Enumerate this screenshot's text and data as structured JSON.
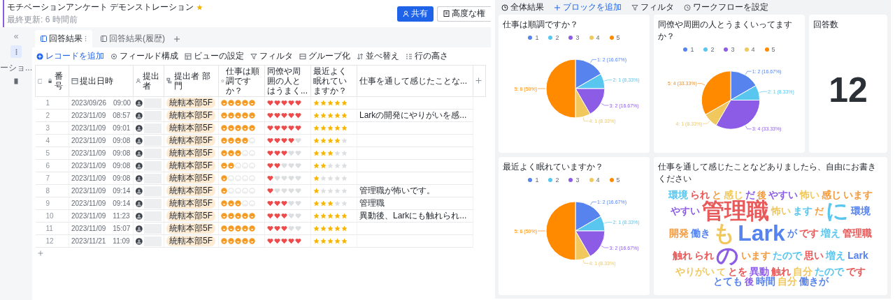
{
  "header": {
    "title": "モチベーションアンケート デモンストレーション",
    "starred": true,
    "subtitle": "最終更新: 6 時間前",
    "buttons": [
      {
        "label": "共有",
        "kind": "primary"
      },
      {
        "label": "高度な権",
        "kind": "outline"
      }
    ]
  },
  "sidebar": {
    "collapse": "«",
    "view_label": "ーショ..."
  },
  "tabs": [
    {
      "label": "回答結果",
      "selected": true
    },
    {
      "label": "回答結果(履歴)",
      "selected": false
    }
  ],
  "toolbar": [
    {
      "label": "レコードを追加",
      "kind": "add"
    },
    {
      "label": "フィールド構成",
      "kind": "fields"
    },
    {
      "label": "ビューの設定",
      "kind": "view"
    },
    {
      "label": "フィルタ",
      "kind": "filter"
    },
    {
      "label": "グループ化",
      "kind": "group"
    },
    {
      "label": "並べ替え",
      "kind": "sort"
    },
    {
      "label": "行の高さ",
      "kind": "height"
    }
  ],
  "table": {
    "select_all": {
      "checked": false
    },
    "columns": [
      {
        "label": "番号",
        "kind": "number"
      },
      {
        "label": "提出日時",
        "kind": "date"
      },
      {
        "label": "提出者",
        "kind": "person"
      },
      {
        "label": "提出者 部門",
        "kind": "dept"
      },
      {
        "label": "仕事は順調ですか？",
        "kind": "rating"
      },
      {
        "label": "同僚や周囲の人とはうまく...",
        "kind": "text"
      },
      {
        "label": "最近よく眠れていますか？",
        "kind": "text"
      },
      {
        "label": "仕事を通して感じたことな...",
        "kind": "text"
      }
    ],
    "rows": [
      {
        "number": "1",
        "date": "2023/09/26",
        "time": "09:00",
        "department": "統轄本部5F",
        "ratings": [
          {
            "kind": "face",
            "stars": 5
          },
          {
            "kind": "heart",
            "stars": 5
          },
          {
            "kind": "star",
            "stars": 5
          }
        ],
        "comment": ""
      },
      {
        "number": "2",
        "date": "2023/11/09",
        "time": "08:57",
        "department": "統轄本部5F",
        "ratings": [
          {
            "kind": "face",
            "stars": 5
          },
          {
            "kind": "heart",
            "stars": 5
          },
          {
            "kind": "star",
            "stars": 5
          }
        ],
        "comment": "Larkの開発にやりがいを感..."
      },
      {
        "number": "3",
        "date": "2023/11/09",
        "time": "09:01",
        "department": "統轄本部5F",
        "ratings": [
          {
            "kind": "face",
            "stars": 5
          },
          {
            "kind": "heart",
            "stars": 5
          },
          {
            "kind": "star",
            "stars": 5
          }
        ],
        "comment": ""
      },
      {
        "number": "4",
        "date": "2023/11/09",
        "time": "09:08",
        "department": "統轄本部5F",
        "ratings": [
          {
            "kind": "face",
            "stars": 4
          },
          {
            "kind": "heart",
            "stars": 4
          },
          {
            "kind": "star",
            "stars": 4
          }
        ],
        "comment": ""
      },
      {
        "number": "5",
        "date": "2023/11/09",
        "time": "09:08",
        "department": "統轄本部5F",
        "ratings": [
          {
            "kind": "face",
            "stars": 3
          },
          {
            "kind": "heart",
            "stars": 3
          },
          {
            "kind": "star",
            "stars": 3
          }
        ],
        "comment": ""
      },
      {
        "number": "6",
        "date": "2023/11/09",
        "time": "09:08",
        "department": "統轄本部5F",
        "ratings": [
          {
            "kind": "face",
            "stars": 2
          },
          {
            "kind": "heart",
            "stars": 2
          },
          {
            "kind": "star",
            "stars": 2
          }
        ],
        "comment": ""
      },
      {
        "number": "7",
        "date": "2023/11/09",
        "time": "09:08",
        "department": "統轄本部5F",
        "ratings": [
          {
            "kind": "face",
            "stars": 1
          },
          {
            "kind": "heart",
            "stars": 1
          },
          {
            "kind": "star",
            "stars": 1
          }
        ],
        "comment": ""
      },
      {
        "number": "8",
        "date": "2023/11/09",
        "time": "09:14",
        "department": "統轄本部5F",
        "ratings": [
          {
            "kind": "face",
            "stars": 1
          },
          {
            "kind": "heart",
            "stars": 1
          },
          {
            "kind": "star",
            "stars": 1
          }
        ],
        "comment": "管理職が怖いです。"
      },
      {
        "number": "9",
        "date": "2023/11/09",
        "time": "09:14",
        "department": "統轄本部5F",
        "ratings": [
          {
            "kind": "face",
            "stars": 3
          },
          {
            "kind": "heart",
            "stars": 3
          },
          {
            "kind": "star",
            "stars": 3
          }
        ],
        "comment": "管理職"
      },
      {
        "number": "10",
        "date": "2023/11/09",
        "time": "11:23",
        "department": "統轄本部5F",
        "ratings": [
          {
            "kind": "face",
            "stars": 5
          },
          {
            "kind": "heart",
            "stars": 3
          },
          {
            "kind": "star",
            "stars": 5
          }
        ],
        "comment": "異動後、Larkにも触れられ..."
      },
      {
        "number": "11",
        "date": "2023/11/09",
        "time": "15:07",
        "department": "統轄本部5F",
        "ratings": [
          {
            "kind": "face",
            "stars": 5
          },
          {
            "kind": "heart",
            "stars": 3
          },
          {
            "kind": "star",
            "stars": 5
          }
        ],
        "comment": ""
      },
      {
        "number": "12",
        "date": "2023/11/21",
        "time": "11:09",
        "department": "統轄本部5F",
        "ratings": [
          {
            "kind": "face",
            "stars": 5
          },
          {
            "kind": "heart",
            "stars": 5
          },
          {
            "kind": "star",
            "stars": 5
          }
        ],
        "comment": ""
      }
    ]
  },
  "dashboard": {
    "title": "全体結果",
    "toolbar": [
      {
        "label": "ブロックを追加",
        "kind": "add"
      },
      {
        "label": "フィルタ",
        "kind": "filter"
      },
      {
        "label": "ワークフローを設定",
        "kind": "workflow"
      }
    ],
    "cards": [
      {
        "kind": "pie",
        "title": "仕事は順調ですか？",
        "legend": [
          {
            "color": "#5683ee"
          },
          {
            "color": "#58c6ef"
          },
          {
            "color": "#8c5ce6"
          },
          {
            "color": "#f0c85e"
          },
          {
            "color": "#ff8a00"
          }
        ],
        "chart_data": {
          "type": "pie",
          "categories": [
            "1",
            "2",
            "3",
            "4",
            "5"
          ],
          "values": [
            2,
            1,
            2,
            1,
            6
          ],
          "value_labels": [
            "1: 2 (16.67%)",
            "2: 1 (8.33%)",
            "3: 2 (16.67%)",
            "4: 1 (8.33%)",
            "5: 6 (50%)"
          ]
        }
      },
      {
        "kind": "pie",
        "title": "同僚や周囲の人とうまくいってますか？",
        "legend": [
          {
            "color": "#5683ee"
          },
          {
            "color": "#58c6ef"
          },
          {
            "color": "#8c5ce6"
          },
          {
            "color": "#f0c85e"
          },
          {
            "color": "#ff8a00"
          }
        ],
        "chart_data": {
          "type": "pie",
          "categories": [
            "1",
            "2",
            "3",
            "4",
            "5"
          ],
          "values": [
            2,
            1,
            4,
            1,
            4
          ],
          "value_labels": [
            "1: 2 (16.67%)",
            "2: 1 (8.33%)",
            "3: 4 (33.33%)",
            "4: 1 (8.33%)",
            "5: 4 (33.33%)"
          ]
        }
      },
      {
        "kind": "metric",
        "title": "回答数",
        "value": "12"
      },
      {
        "kind": "pie",
        "title": "最近よく眠れていますか？",
        "legend": [
          {
            "color": "#5683ee"
          },
          {
            "color": "#58c6ef"
          },
          {
            "color": "#8c5ce6"
          },
          {
            "color": "#f0c85e"
          },
          {
            "color": "#ff8a00"
          }
        ],
        "chart_data": {
          "type": "pie",
          "categories": [
            "1",
            "2",
            "3",
            "4",
            "5"
          ],
          "values": [
            2,
            1,
            2,
            1,
            6
          ],
          "value_labels": [
            "1: 2 (16.67%)",
            "2: 1 (8.33%)",
            "3: 2 (16.67%)",
            "4: 1 (8.33%)",
            "5: 6 (50%)"
          ]
        }
      },
      {
        "kind": "wordcloud",
        "title": "仕事を通して感じたことなどありましたら、自由にお書きください",
        "words": [
          {
            "text": "環境",
            "color": "#58c6ef",
            "kind": "m"
          },
          {
            "text": "られ",
            "color": "#e85a5a",
            "kind": "m"
          },
          {
            "text": "と",
            "color": "#f59a3c",
            "kind": "m"
          },
          {
            "text": "感じ",
            "color": "#f0c85e",
            "kind": "m"
          },
          {
            "text": "だ",
            "color": "#8c5ce6",
            "kind": "m"
          },
          {
            "text": "後",
            "color": "#f59a3c",
            "kind": "s"
          },
          {
            "text": "やすい",
            "color": "#8c5ce6",
            "kind": "m"
          },
          {
            "text": "怖い",
            "color": "#f0c85e",
            "kind": "m"
          },
          {
            "text": "感じ",
            "color": "#f59a3c",
            "kind": "m"
          },
          {
            "text": "います",
            "color": "#f59a3c",
            "kind": "m"
          },
          {
            "text": "やすい",
            "color": "#8c5ce6",
            "kind": "m"
          },
          {
            "text": "管理職",
            "color": "#e85a5a",
            "kind": "xl"
          },
          {
            "text": "怖い",
            "color": "#f0c85e",
            "kind": "m"
          },
          {
            "text": "ます",
            "color": "#58c6ef",
            "kind": "m"
          },
          {
            "text": "だ",
            "color": "#f59a3c",
            "kind": "s"
          },
          {
            "text": "に",
            "color": "#58c6ef",
            "kind": "xl"
          },
          {
            "text": "環境",
            "color": "#5683ee",
            "kind": "m"
          },
          {
            "text": "開発",
            "color": "#f59a3c",
            "kind": "m"
          },
          {
            "text": "働き",
            "color": "#5683ee",
            "kind": "m"
          },
          {
            "text": "も",
            "color": "#f0c85e",
            "kind": "xl"
          },
          {
            "text": "Lark",
            "color": "#5683ee",
            "kind": "xl"
          },
          {
            "text": "が",
            "color": "#5683ee",
            "kind": "m"
          },
          {
            "text": "です",
            "color": "#e85a5a",
            "kind": "m"
          },
          {
            "text": "増え",
            "color": "#58c6ef",
            "kind": "m"
          },
          {
            "text": "管理職",
            "color": "#e85a5a",
            "kind": "m"
          },
          {
            "text": "触れ",
            "color": "#e85a5a",
            "kind": "m"
          },
          {
            "text": "られ",
            "color": "#e85a5a",
            "kind": "m"
          },
          {
            "text": "の",
            "color": "#8c5ce6",
            "kind": "xl"
          },
          {
            "text": "います",
            "color": "#f59a3c",
            "kind": "m"
          },
          {
            "text": "たので",
            "color": "#58c6ef",
            "kind": "m"
          },
          {
            "text": "思い",
            "color": "#e85a5a",
            "kind": "m"
          },
          {
            "text": "増え",
            "color": "#58c6ef",
            "kind": "m"
          },
          {
            "text": "Lark",
            "color": "#5683ee",
            "kind": "m"
          },
          {
            "text": "やりがい",
            "color": "#f0c85e",
            "kind": "m"
          },
          {
            "text": "て",
            "color": "#f0c85e",
            "kind": "s"
          },
          {
            "text": "とを",
            "color": "#e85a5a",
            "kind": "m"
          },
          {
            "text": "異動",
            "color": "#8c5ce6",
            "kind": "m"
          },
          {
            "text": "触れ",
            "color": "#e85a5a",
            "kind": "m"
          },
          {
            "text": "自分",
            "color": "#f0c85e",
            "kind": "m"
          },
          {
            "text": "たので",
            "color": "#58c6ef",
            "kind": "m"
          },
          {
            "text": "です",
            "color": "#e85a5a",
            "kind": "m"
          },
          {
            "text": "とても",
            "color": "#5683ee",
            "kind": "m"
          },
          {
            "text": "後",
            "color": "#8c5ce6",
            "kind": "s"
          },
          {
            "text": "時間",
            "color": "#5683ee",
            "kind": "m"
          },
          {
            "text": "自分",
            "color": "#f0c85e",
            "kind": "m"
          },
          {
            "text": "働きが",
            "color": "#5683ee",
            "kind": "m"
          }
        ]
      }
    ]
  }
}
